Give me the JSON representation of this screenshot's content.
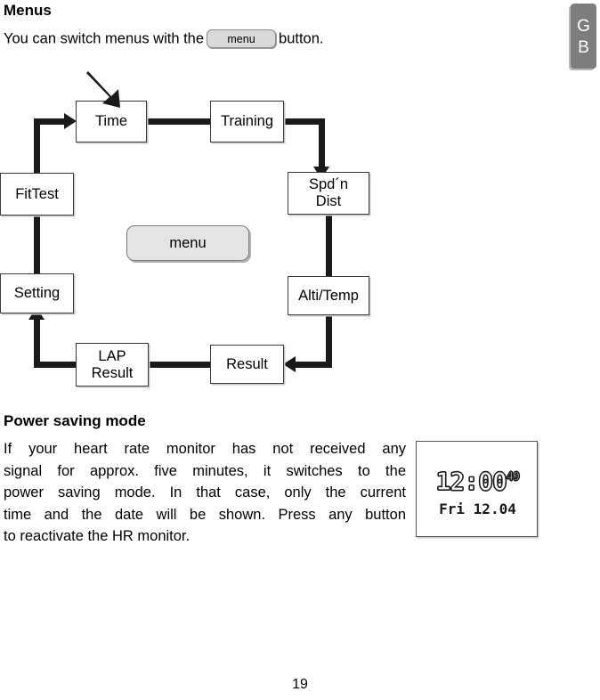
{
  "language_tab": {
    "line1": "G",
    "line2": "B"
  },
  "sections": {
    "menus": {
      "heading": "Menus",
      "intro_before": "You can switch menus with the",
      "intro_button_label": "menu",
      "intro_after": "button."
    },
    "power_saving": {
      "heading": "Power saving mode",
      "paragraph_lines": [
        "If  your  heart  rate  monitor  has  not  received  any",
        "signal  for  approx.  five  minutes,  it  switches  to  the",
        "power  saving  mode.  In  that  case,  only  the  current",
        "time  and  the  date  will  be  shown.  Press  any  button",
        "to reactivate the HR monitor."
      ]
    }
  },
  "diagram": {
    "center_button_label": "menu",
    "nodes": [
      {
        "id": "time",
        "label_lines": [
          "Time"
        ]
      },
      {
        "id": "training",
        "label_lines": [
          "Training"
        ]
      },
      {
        "id": "spdndist",
        "label_lines": [
          "Spd´n",
          "Dist"
        ]
      },
      {
        "id": "altitemp",
        "label_lines": [
          "Alti/Temp"
        ]
      },
      {
        "id": "result",
        "label_lines": [
          "Result"
        ]
      },
      {
        "id": "lapresult",
        "label_lines": [
          "LAP",
          "Result"
        ]
      },
      {
        "id": "setting",
        "label_lines": [
          "Setting"
        ]
      },
      {
        "id": "fittest",
        "label_lines": [
          "FitTest"
        ]
      }
    ],
    "flow_order": [
      "Time",
      "Training",
      "Spd´n Dist",
      "Alti/Temp",
      "Result",
      "LAP Result",
      "Setting",
      "FitTest"
    ],
    "line_color": "#1a1a1a",
    "node_fill": "#ffffff"
  },
  "lcd": {
    "time": "12:00",
    "seconds": "49",
    "date": "Fri 12.04"
  },
  "page_number": "19"
}
